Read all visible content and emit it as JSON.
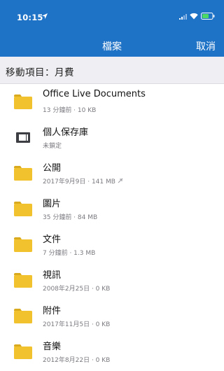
{
  "status": {
    "time": "10:15"
  },
  "nav": {
    "title": "檔案",
    "cancel": "取消"
  },
  "move": {
    "label": "移動項目：月費"
  },
  "items": [
    {
      "name": "Office Live Documents",
      "meta": "13 分鐘前 · 10 KB",
      "icon": "folder-icon"
    },
    {
      "name": "個人保存庫",
      "meta": "未鎖定",
      "icon": "vault-icon"
    },
    {
      "name": "公開",
      "meta": "2017年9月9日 · 141 MB",
      "icon": "folder-icon",
      "shared": true
    },
    {
      "name": "圖片",
      "meta": "35 分鐘前 · 84 MB",
      "icon": "folder-icon"
    },
    {
      "name": "文件",
      "meta": "7 分鐘前 · 1.3 MB",
      "icon": "folder-icon"
    },
    {
      "name": "視訊",
      "meta": "2008年2月25日 · 0 KB",
      "icon": "folder-icon"
    },
    {
      "name": "附件",
      "meta": "2017年11月5日 · 0 KB",
      "icon": "folder-icon"
    },
    {
      "name": "音樂",
      "meta": "2012年8月22日 · 0 KB",
      "icon": "folder-icon"
    }
  ],
  "colors": {
    "brand": "#1f73c7",
    "folder": "#f2c12e"
  }
}
